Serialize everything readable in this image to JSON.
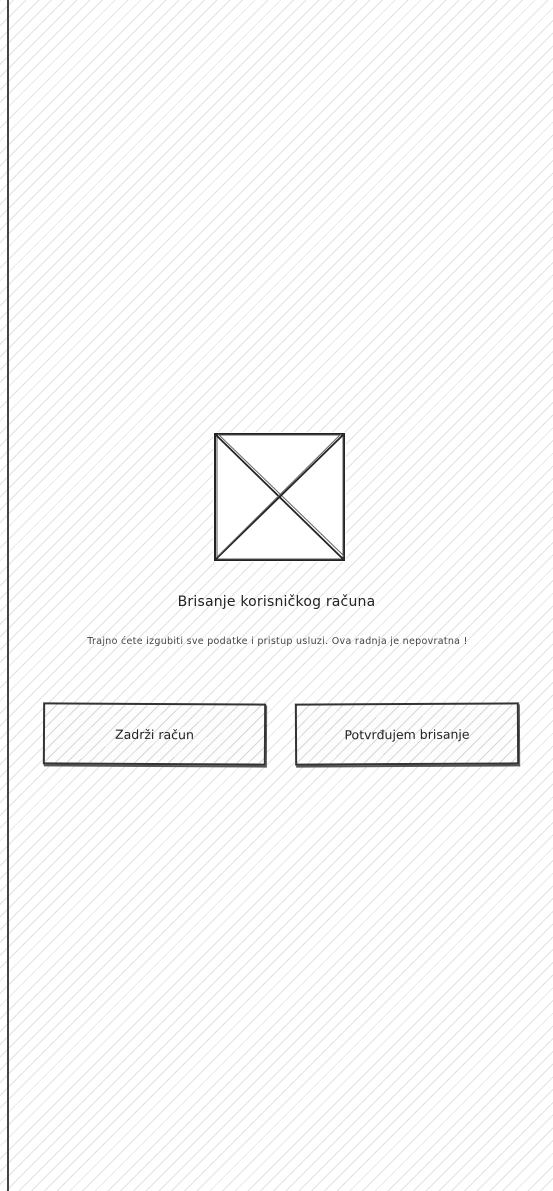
{
  "dialog": {
    "title": "Brisanje korisničkog računa",
    "message": "Trajno ćete izgubiti sve podatke i pristup usluzi. Ova radnja je nepovratna !",
    "image_icon": "image-placeholder-icon"
  },
  "buttons": {
    "keep_label": "Zadrži račun",
    "confirm_label": "Potvrđujem brisanje"
  }
}
